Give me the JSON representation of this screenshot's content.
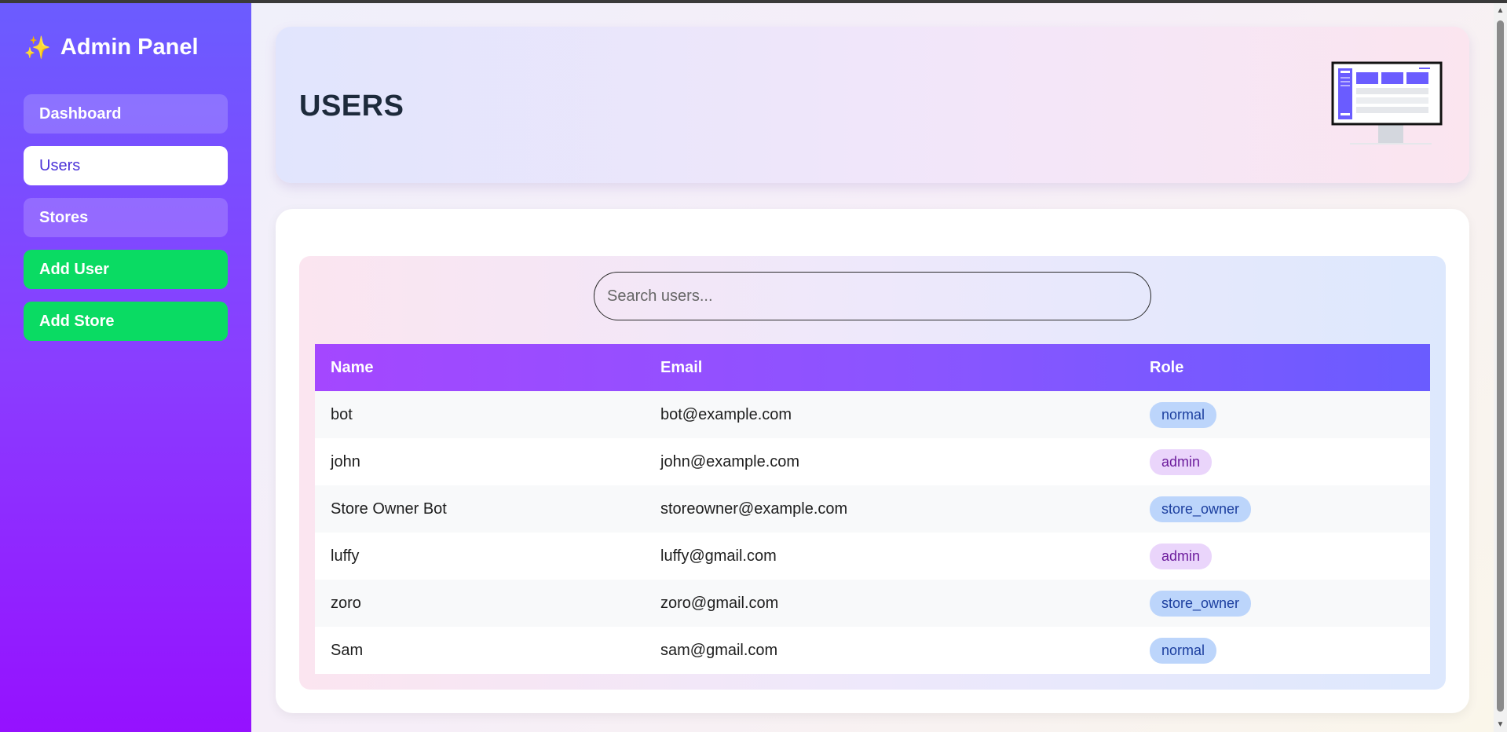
{
  "sidebar": {
    "brand": "Admin Panel",
    "brand_icon": "sparkles-icon",
    "items": [
      {
        "label": "Dashboard",
        "active": false
      },
      {
        "label": "Users",
        "active": true
      },
      {
        "label": "Stores",
        "active": false
      },
      {
        "label": "Add User",
        "active": false
      },
      {
        "label": "Add Store",
        "active": false
      }
    ]
  },
  "header": {
    "title": "USERS",
    "illustration": "monitor-dashboard-icon"
  },
  "search": {
    "placeholder": "Search users...",
    "value": ""
  },
  "table": {
    "columns": [
      "Name",
      "Email",
      "Role"
    ],
    "rows": [
      {
        "name": "bot",
        "email": "bot@example.com",
        "role": "normal"
      },
      {
        "name": "john",
        "email": "john@example.com",
        "role": "admin"
      },
      {
        "name": "Store Owner Bot",
        "email": "storeowner@example.com",
        "role": "store_owner"
      },
      {
        "name": "luffy",
        "email": "luffy@gmail.com",
        "role": "admin"
      },
      {
        "name": "zoro",
        "email": "zoro@gmail.com",
        "role": "store_owner"
      },
      {
        "name": "Sam",
        "email": "sam@gmail.com",
        "role": "normal"
      }
    ]
  },
  "colors": {
    "sidebar_top": "#6b5cff",
    "sidebar_bottom": "#9511ff",
    "accent_green": "#0adb63",
    "header_text": "#1d2a3b"
  }
}
